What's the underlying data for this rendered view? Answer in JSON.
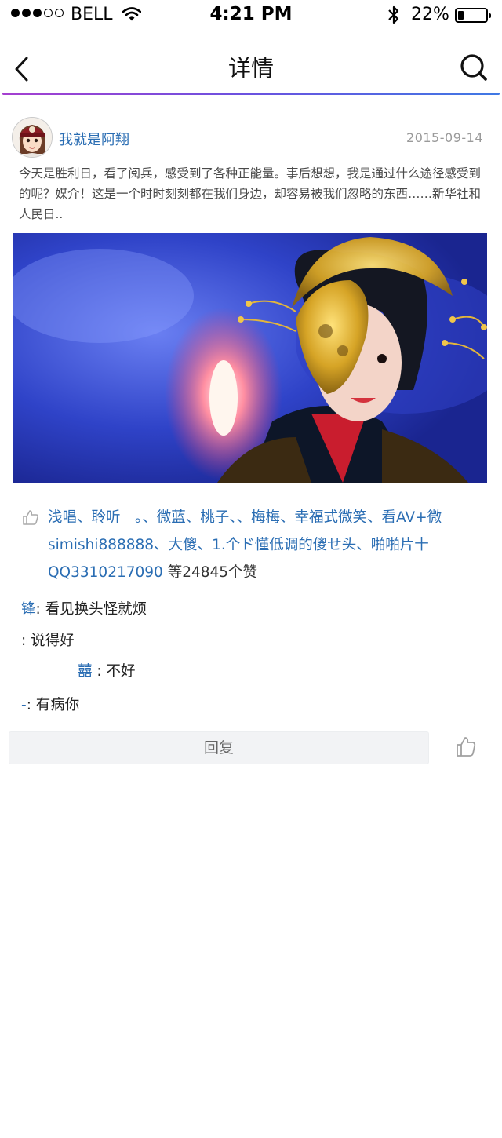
{
  "status_bar": {
    "carrier": "BELL",
    "time": "4:21 PM",
    "battery": "22%",
    "battery_level": 0.22
  },
  "nav": {
    "title": "详情"
  },
  "post": {
    "username": "我就是阿翔",
    "date": "2015-09-14",
    "text": "今天是胜利日，看了阅兵，感受到了各种正能量。事后想想，我是通过什么途径感受到的呢？媒介！这是一个时时刻刻都在我们身边，却容易被我们忽略的东西……新华社和人民日.."
  },
  "likes": {
    "users_text": "浅唱、聆听＿。、微蓝、桃子、、梅梅、幸福式微笑、看AV+微simishi888888、大傻、1.个ド懂低调的傻せ头、啪啪片十QQ3310217090",
    "count_text": " 等24845个赞"
  },
  "comments": [
    {
      "user": "锋",
      "text": ": 看见换头怪就烦"
    },
    {
      "user": "",
      "text": ": 说得好"
    },
    {
      "user": "囍",
      "text": " : 不好"
    },
    {
      "user": "-",
      "text": ": 有病你"
    }
  ],
  "bottom_bar": {
    "reply_placeholder": "回复"
  },
  "icons": {
    "back": "chevron-left-icon",
    "search": "search-icon",
    "like": "thumbs-up-icon",
    "wifi": "wifi-icon",
    "bluetooth": "bluetooth-icon"
  },
  "colors": {
    "link_blue": "#2a6db3",
    "nav_gradient": [
      "#a53fd0",
      "#3f79e4"
    ]
  }
}
